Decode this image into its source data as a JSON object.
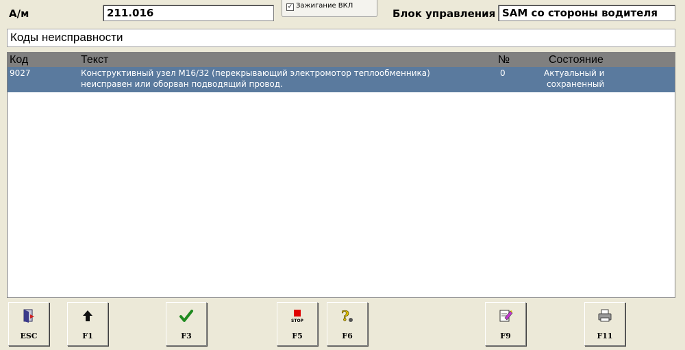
{
  "header": {
    "vehicle_label": "А/м",
    "vehicle_value": "211.016",
    "ignition_label": "Зажигание ВКЛ",
    "control_unit_label": "Блок управления",
    "control_unit_value": "SAM со стороны водителя"
  },
  "section_title": "Коды неисправности",
  "table": {
    "columns": [
      "Код",
      "Текст",
      "№",
      "Состояние"
    ],
    "rows": [
      {
        "code": "9027",
        "text_line1": "Конструктивный узел M16/32 (перекрывающий электромотор теплообменника)",
        "text_line2": "неисправен или оборван подводящий провод.",
        "number": "0",
        "state_line1": "Актуальный и",
        "state_line2": "сохраненный"
      }
    ]
  },
  "buttons": [
    {
      "key": "ESC",
      "icon": "exit-door-icon"
    },
    {
      "key": "F1",
      "icon": "arrow-up-icon"
    },
    {
      "key": "F3",
      "icon": "checkmark-icon"
    },
    {
      "key": "F5",
      "icon": "stop-icon",
      "icon_text": "STOP"
    },
    {
      "key": "F6",
      "icon": "help-question-icon"
    },
    {
      "key": "F9",
      "icon": "edit-document-icon"
    },
    {
      "key": "F11",
      "icon": "printer-icon"
    }
  ],
  "colors": {
    "selected_row": "#5a7a9e",
    "header_bg": "#808080",
    "window_bg": "#ece9d8"
  }
}
